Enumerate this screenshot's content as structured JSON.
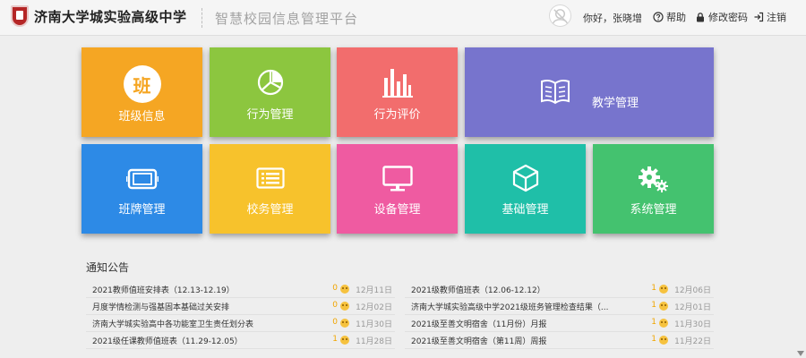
{
  "header": {
    "school_name": "济南大学城实验高级中学",
    "platform_title": "智慧校园信息管理平台",
    "greeting": "你好，张晓增",
    "help": "帮助",
    "change_password": "修改密码",
    "logout": "注销"
  },
  "tiles": {
    "class_info": {
      "label": "班级信息",
      "badge": "班",
      "color": "#f5a623",
      "icon": "class-badge-icon"
    },
    "behavior_mgmt": {
      "label": "行为管理",
      "color": "#8cc63f",
      "icon": "pie-chart-icon"
    },
    "behavior_eval": {
      "label": "行为评价",
      "color": "#f26d6d",
      "icon": "bar-chart-icon"
    },
    "teaching_mgmt": {
      "label": "教学管理",
      "color": "#7774cd",
      "icon": "open-book-icon"
    },
    "signboard_mgmt": {
      "label": "班牌管理",
      "color": "#2d8ae6",
      "icon": "tablet-icon"
    },
    "school_affairs": {
      "label": "校务管理",
      "color": "#f7c22c",
      "icon": "list-icon"
    },
    "device_mgmt": {
      "label": "设备管理",
      "color": "#ef5ba1",
      "icon": "monitor-icon"
    },
    "basic_mgmt": {
      "label": "基础管理",
      "color": "#1fbfa8",
      "icon": "cube-icon"
    },
    "system_mgmt": {
      "label": "系统管理",
      "color": "#44c26f",
      "icon": "gears-icon"
    }
  },
  "notices": {
    "title": "通知公告",
    "left": [
      {
        "title": "2021教师值班安排表（12.13-12.19）",
        "count": "0",
        "date": "12月11日"
      },
      {
        "title": "月度学情检测与强基固本基础过关安排",
        "count": "0",
        "date": "12月02日"
      },
      {
        "title": "济南大学城实验高中各功能室卫生责任划分表",
        "count": "0",
        "date": "11月30日"
      },
      {
        "title": "2021级任课教师值班表（11.29-12.05）",
        "count": "1",
        "date": "11月28日"
      }
    ],
    "right": [
      {
        "title": "2021级教师值班表（12.06-12.12）",
        "count": "1",
        "date": "12月06日"
      },
      {
        "title": "济南大学城实验高级中学2021级班务管理检查结果（...",
        "count": "1",
        "date": "12月01日"
      },
      {
        "title": "2021级至善文明宿舍（11月份）月报",
        "count": "1",
        "date": "11月30日"
      },
      {
        "title": "2021级至善文明宿舍（第11周）周报",
        "count": "1",
        "date": "11月22日"
      }
    ]
  }
}
